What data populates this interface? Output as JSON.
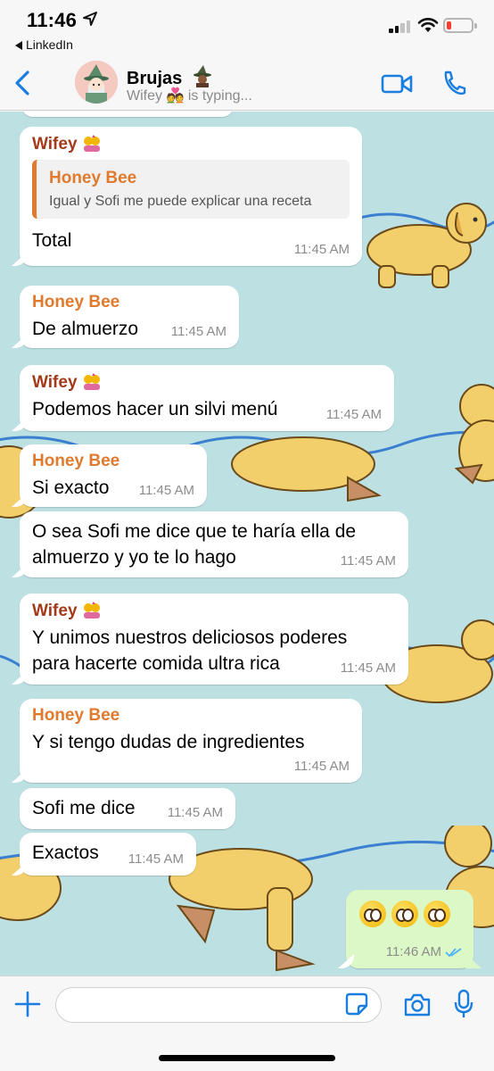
{
  "status_bar": {
    "time": "11:46",
    "back_app": "LinkedIn"
  },
  "header": {
    "title": "Brujas",
    "subtitle": "Wifey 💑 is typing..."
  },
  "messages": [
    {
      "sender": "Wifey",
      "quote_name": "Honey Bee",
      "quote_text": "Igual y Sofi me puede explicar una receta",
      "text": "Total",
      "time": "11:45 AM"
    },
    {
      "sender": "Honey Bee",
      "text": "De almuerzo",
      "time": "11:45 AM"
    },
    {
      "sender": "Wifey",
      "text": "Podemos hacer un silvi menú",
      "time": "11:45 AM"
    },
    {
      "sender": "Honey Bee",
      "text": "Si exacto",
      "time": "11:45 AM"
    },
    {
      "text_line1": "O sea Sofi me dice que te haría ella de",
      "text_line2": "almuerzo y yo te lo hago",
      "time": "11:45 AM"
    },
    {
      "sender": "Wifey",
      "text_line1": "Y unimos nuestros deliciosos poderes",
      "text_line2": "para hacerte comida ultra rica",
      "time": "11:45 AM"
    },
    {
      "sender": "Honey Bee",
      "text": "Y si tengo dudas de ingredientes",
      "time": "11:45 AM"
    },
    {
      "text": "Sofi me dice",
      "time": "11:45 AM"
    },
    {
      "text": "Exactos",
      "time": "11:45 AM"
    },
    {
      "emoji": "pleading-face x3",
      "time": "11:46 AM",
      "read": true
    }
  ],
  "colors": {
    "wifey": "#a33a1a",
    "honey_bee": "#e07a2e",
    "outgoing": "#dcf8c6",
    "wallpaper": "#bde0e3",
    "accent": "#1a7ee0"
  }
}
